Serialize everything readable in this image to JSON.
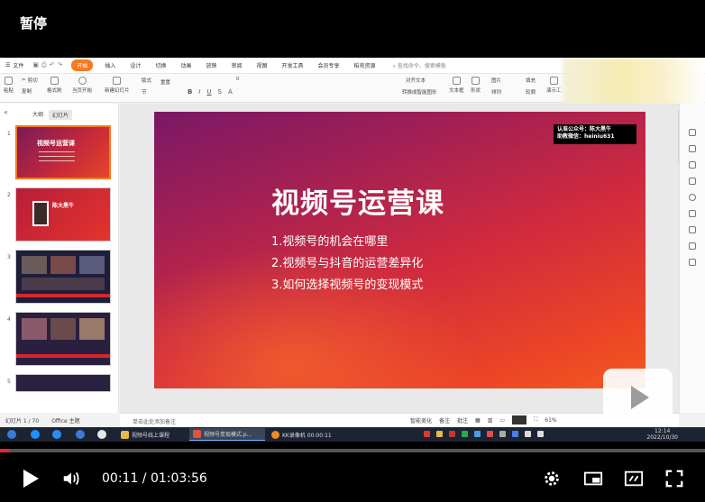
{
  "player": {
    "status_label": "暂停",
    "time": "00:11 / 01:03:56",
    "progress": 0.0029
  },
  "menu": {
    "file": "文件",
    "tabs": [
      "开始",
      "插入",
      "设计",
      "切换",
      "动画",
      "放映",
      "审阅",
      "视图",
      "开发工具",
      "会员专享",
      "稻壳资源"
    ],
    "active_tab": "开始",
    "search": "查找命令、搜索模板"
  },
  "ribbon": {
    "paste": "粘贴",
    "cut": "剪切",
    "copy": "复制",
    "format_painter": "格式刷",
    "from_start": "当页开始",
    "new_slide": "新建幻灯片",
    "layout": "版式",
    "section": "节",
    "reset": "重置",
    "font_size": "0",
    "text_align": "对齐文本",
    "smart_art": "转换成智能图形",
    "textbox": "文本框",
    "shape": "形状",
    "arrange": "排列",
    "picture": "图片",
    "fill": "填充",
    "outline": "轮廓",
    "presenter": "演示工"
  },
  "thumbs": {
    "tab_outline": "大纲",
    "tab_slides": "幻灯片",
    "slide1_title": "视频号运营课",
    "slide2_name": "陈大黑牛",
    "numbers": [
      "1",
      "2",
      "3",
      "4",
      "5"
    ]
  },
  "slide": {
    "title": "视频号运营课",
    "points": [
      "1.视频号的机会在哪里",
      "2.视频号与抖音的运营差异化",
      "3.如何选择视频号的变现模式"
    ],
    "watermark_line1": "认准公众号：陈大黑牛",
    "watermark_line2": "助教微信：heiniu631"
  },
  "notes": "单击此处添加备注",
  "status": {
    "slide_count": "幻灯片 1 / 70",
    "theme": "Office 主题",
    "smart_beautify": "智能美化",
    "notes_btn": "备注",
    "comments_btn": "批注",
    "zoom": "61%"
  },
  "taskbar": {
    "app1": "视频号线上课程",
    "app2": "视频号变现模式.p...",
    "app3": "KK录像机 00:00:11",
    "clock_time": "12:14",
    "clock_date": "2022/10/30"
  },
  "colors": {
    "accent": "#f47b20",
    "progress": "#e02a2a",
    "slide_start": "#7a1866",
    "slide_end": "#f25a1e"
  }
}
